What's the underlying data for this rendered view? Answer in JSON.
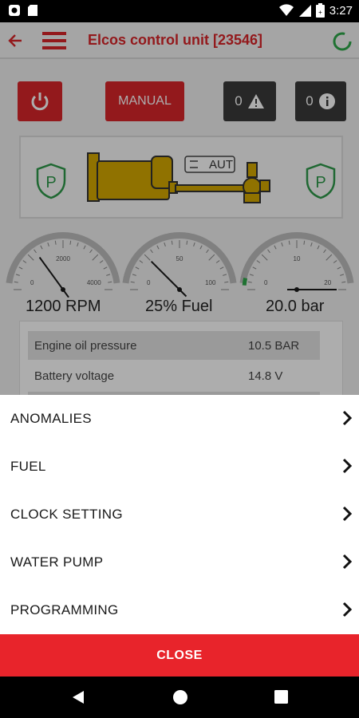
{
  "status_bar": {
    "time": "3:27"
  },
  "app": {
    "title": "Elcos control unit [23546]",
    "buttons": {
      "manual_label": "MANUAL",
      "anomalies_count": "0",
      "info_count": "0"
    },
    "diagram": {
      "mode_label": "AUT"
    },
    "gauges": [
      {
        "label": "1200 RPM",
        "ticks": [
          "0",
          "2000",
          "4000"
        ],
        "value": 1200,
        "max": 4000
      },
      {
        "label": "25% Fuel",
        "ticks": [
          "0",
          "50",
          "100"
        ],
        "value": 25,
        "max": 100
      },
      {
        "label": "20.0 bar",
        "ticks": [
          "0",
          "10",
          "20"
        ],
        "value": 20,
        "max": 20
      }
    ],
    "table": [
      {
        "key": "Engine oil pressure",
        "value": "10.5 BAR"
      },
      {
        "key": "Battery voltage",
        "value": "14.8 V"
      }
    ]
  },
  "sheet": {
    "items": [
      {
        "label": "ANOMALIES"
      },
      {
        "label": "FUEL"
      },
      {
        "label": "CLOCK SETTING"
      },
      {
        "label": "WATER PUMP"
      },
      {
        "label": "PROGRAMMING"
      }
    ],
    "close_label": "CLOSE"
  },
  "colors": {
    "accent": "#d9252a",
    "close": "#e8242b",
    "shield": "#2e9a4a",
    "engine": "#d4a800"
  }
}
